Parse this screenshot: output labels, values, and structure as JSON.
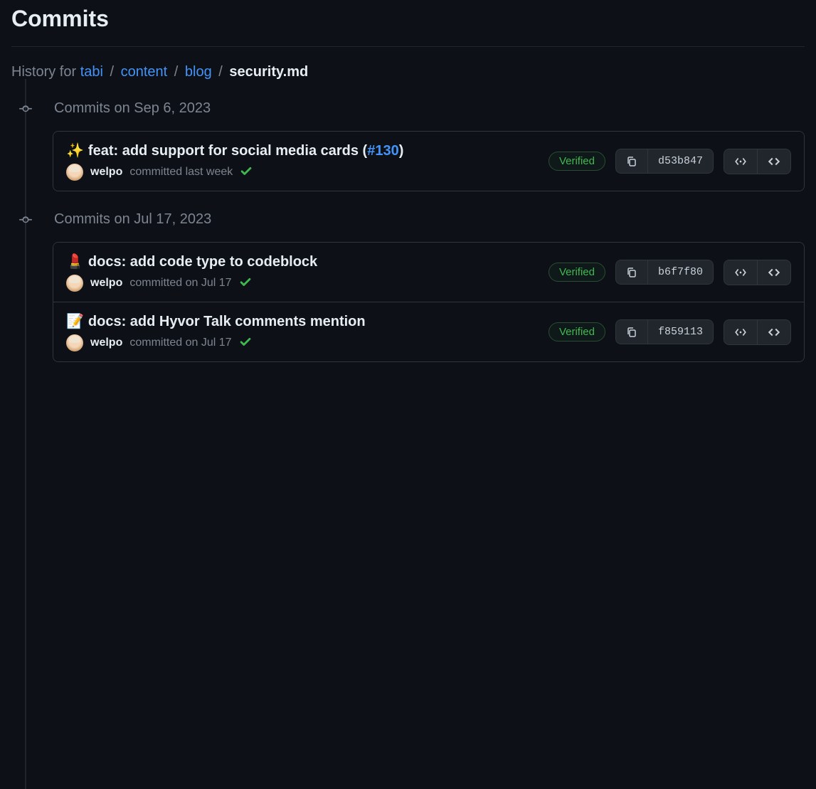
{
  "page_title": "Commits",
  "breadcrumb": {
    "prefix": "History for",
    "parts": [
      {
        "label": "tabi",
        "link": true
      },
      {
        "label": "content",
        "link": true
      },
      {
        "label": "blog",
        "link": true
      },
      {
        "label": "security.md",
        "link": false
      }
    ]
  },
  "groups": [
    {
      "title": "Commits on Sep 6, 2023",
      "commits": [
        {
          "emoji": "✨",
          "title_prefix": "feat: add support for social media cards (",
          "pr": "#130",
          "title_suffix": ")",
          "author": "welpo",
          "committed_text": "committed last week",
          "verified": "Verified",
          "sha": "d53b847"
        }
      ]
    },
    {
      "title": "Commits on Jul 17, 2023",
      "commits": [
        {
          "emoji": "💄",
          "title_prefix": "docs: add code type to codeblock",
          "pr": "",
          "title_suffix": "",
          "author": "welpo",
          "committed_text": "committed on Jul 17",
          "verified": "Verified",
          "sha": "b6f7f80"
        },
        {
          "emoji": "📝",
          "title_prefix": "docs: add Hyvor Talk comments mention",
          "pr": "",
          "title_suffix": "",
          "author": "welpo",
          "committed_text": "committed on Jul 17",
          "verified": "Verified",
          "sha": "f859113"
        }
      ]
    }
  ]
}
